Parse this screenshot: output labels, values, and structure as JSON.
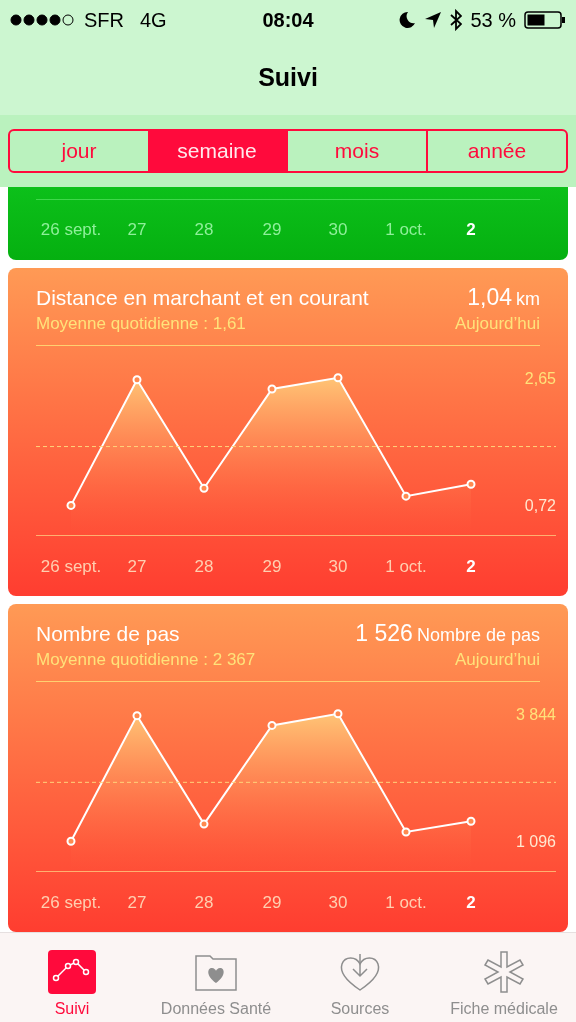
{
  "status_bar": {
    "carrier": "SFR",
    "network": "4G",
    "time": "08:04",
    "battery": "53 %"
  },
  "nav": {
    "title": "Suivi"
  },
  "segments": [
    {
      "label": "jour",
      "selected": false
    },
    {
      "label": "semaine",
      "selected": true
    },
    {
      "label": "mois",
      "selected": false
    },
    {
      "label": "année",
      "selected": false
    }
  ],
  "partial_card": {
    "days": [
      {
        "label": "26 sept.",
        "selected": false
      },
      {
        "label": "27",
        "selected": false
      },
      {
        "label": "28",
        "selected": false
      },
      {
        "label": "29",
        "selected": false
      },
      {
        "label": "30",
        "selected": false
      },
      {
        "label": "1 oct.",
        "selected": false
      },
      {
        "label": "2",
        "selected": true
      }
    ]
  },
  "cards": [
    {
      "title": "Distance en marchant et en courant",
      "value": "1,04",
      "unit": "km",
      "average": "Moyenne quotidienne : 1,61",
      "day": "Aujourd’hui",
      "days": [
        {
          "selected": false
        },
        {
          "selected": false
        },
        {
          "selected": false
        },
        {
          "selected": false
        },
        {
          "selected": false
        },
        {
          "selected": false
        },
        {
          "selected": true
        }
      ],
      "chart_data": {
        "type": "area",
        "categories": [
          "26 sept.",
          "27",
          "28",
          "29",
          "30",
          "1 oct.",
          "2"
        ],
        "series": [
          {
            "color": "#ffffff",
            "values": [
              0.72,
              2.62,
              0.98,
              2.48,
              2.65,
              0.86,
              1.04
            ]
          }
        ],
        "ylim": [
          -0.65,
          4.31
        ],
        "yticks": [
          {
            "value": 2.65,
            "label": "2,65"
          },
          {
            "value": 0.72,
            "label": "0,72"
          }
        ],
        "ref_lines": [
          {
            "axis": "y",
            "value": 1.61
          }
        ]
      }
    },
    {
      "title": "Nombre de pas",
      "value": "1 526",
      "unit": "Nombre de pas",
      "average": "Moyenne quotidienne : 2 367",
      "day": "Aujourd’hui",
      "days": [
        {
          "selected": false
        },
        {
          "selected": false
        },
        {
          "selected": false
        },
        {
          "selected": false
        },
        {
          "selected": false
        },
        {
          "selected": false
        },
        {
          "selected": true
        }
      ],
      "chart_data": {
        "type": "area",
        "categories": [
          "26 sept.",
          "27",
          "28",
          "29",
          "30",
          "1 oct.",
          "2"
        ],
        "series": [
          {
            "color": "#ffffff",
            "values": [
              1100,
              3800,
              1470,
              3590,
              3840,
              1300,
              1530
            ]
          }
        ],
        "ylim": [
          -850,
          6200
        ],
        "yticks": [
          {
            "value": 3844,
            "label": "3 844"
          },
          {
            "value": 1096,
            "label": "1 096"
          }
        ],
        "ref_lines": [
          {
            "axis": "y",
            "value": 2367
          }
        ]
      }
    }
  ],
  "tab_bar": [
    {
      "label": "Suivi",
      "selected": true
    },
    {
      "label": "Données Santé",
      "selected": false
    },
    {
      "label": "Sources",
      "selected": false
    },
    {
      "label": "Fiche médicale",
      "selected": false
    }
  ]
}
